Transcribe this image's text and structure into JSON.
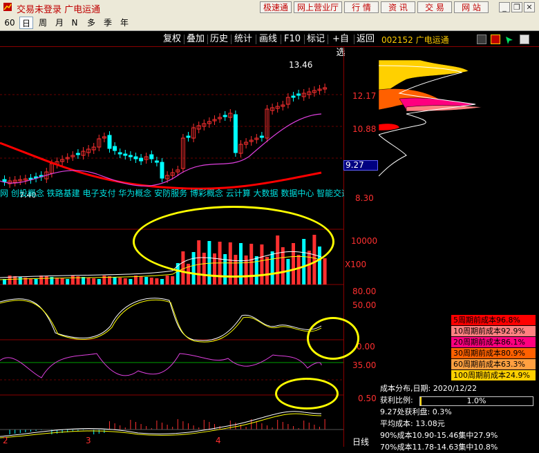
{
  "window": {
    "title": "交易未登录  广电运通",
    "buttons": [
      "极速通",
      "网上营业厅",
      "行 情",
      "资 讯",
      "交 易",
      "网 站"
    ]
  },
  "periods": {
    "items": [
      "60",
      "日",
      "周",
      "月",
      "N",
      "多",
      "季",
      "年"
    ],
    "selected": "日"
  },
  "toolbar": {
    "items": [
      "复权",
      "叠加",
      "历史",
      "统计",
      "画线",
      "F10",
      "标记",
      "+自选",
      "返回"
    ]
  },
  "stock": {
    "code_name": "002152 广电运通"
  },
  "price_axis": {
    "labels": [
      "13.46",
      "12.17",
      "10.88",
      "9.27",
      "8.30",
      "7.40"
    ],
    "current_price": "9.27"
  },
  "concepts": {
    "text": "网 创投概念 铁路基建 电子支付 华为概念 安防服务 博彩概念 云计算 大数据 数据中心 智能交通"
  },
  "volume": {
    "axis_label": "10000",
    "unit": "X100"
  },
  "kdj": {
    "labels": [
      "80.00",
      "50.00"
    ]
  },
  "rsi": {
    "labels": [
      "0.00",
      "35.00"
    ]
  },
  "macd": {
    "labels": [
      "0.50"
    ]
  },
  "date_axis": {
    "labels": [
      "2",
      "3",
      "4"
    ],
    "mode": "日线"
  },
  "cost_distribution": {
    "legend": [
      {
        "text": "5周期前成本96.8%",
        "color": "#ff0000",
        "fg": "#000000"
      },
      {
        "text": "10周期前成本92.9%",
        "color": "#ff8080",
        "fg": "#000000"
      },
      {
        "text": "20周期前成本86.1%",
        "color": "#ff007f",
        "fg": "#000000"
      },
      {
        "text": "30周期前成本80.9%",
        "color": "#ff6000",
        "fg": "#000000"
      },
      {
        "text": "60周期前成本63.3%",
        "color": "#ffa040",
        "fg": "#000000"
      },
      {
        "text": "100周期前成本24.9%",
        "color": "#ffd000",
        "fg": "#000000"
      }
    ],
    "date_line": "成本分布,日期: 2020/12/22",
    "profit_label": "获利比例:",
    "profit_value": "1.0%",
    "profit_fraction": 0.01,
    "line1": "9.27处获利盘: 0.3%",
    "line2": "平均成本: 13.08元",
    "line3": "90%成本10.90-15.46集中27.9%",
    "line4": "70%成本11.78-14.63集中10.8%"
  },
  "colors": {
    "up": "#ff3030",
    "down": "#00ffff",
    "ma_long": "#ff0000",
    "ma_short": "#e040e0",
    "highlight": "#ffff00"
  }
}
